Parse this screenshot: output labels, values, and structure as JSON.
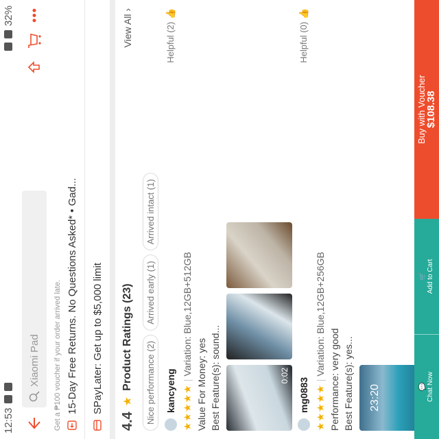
{
  "status_bar": {
    "time": "12:53",
    "battery": "32%"
  },
  "header": {
    "search_placeholder": "Xiaomi Pad"
  },
  "cut_text": "Get a ₱100 voucher if your order arrived late.",
  "returns": {
    "text": "15-Day Free Returns. No Questions Asked* • Gad..."
  },
  "paylater": {
    "text": "SPayLater: Get up to $5,000 limit"
  },
  "ratings": {
    "score": "4.4",
    "title": "Product Ratings (23)",
    "view_all": "View All",
    "tags": [
      "Nice performance (2)",
      "Arrived early (1)",
      "Arrived intact (1)"
    ]
  },
  "reviews": [
    {
      "username": "kancyeng",
      "stars": "★★★★★",
      "variation": "Variation: Blue,12GB+512GB",
      "line1": "Value For Money: yes",
      "line2": "Best Feature(s): sound...",
      "helpful": "Helpful (2)",
      "video_duration": "0:02"
    },
    {
      "username": "mg0883",
      "stars": "★★★★★",
      "variation": "Variation: Blue,12GB+256GB",
      "line1": "Performance: very good",
      "line2": "Best Feature(s): yes...",
      "helpful": "Helpful (0)",
      "clock": "23:20"
    }
  ],
  "bottom_bar": {
    "chat_label": "Chat Now",
    "cart_label": "Add to Cart",
    "buy_label": "Buy with Voucher",
    "buy_price": "$108.38"
  },
  "colors": {
    "accent": "#ee4d2d",
    "teal": "#26aa99",
    "star": "#f5b100"
  }
}
